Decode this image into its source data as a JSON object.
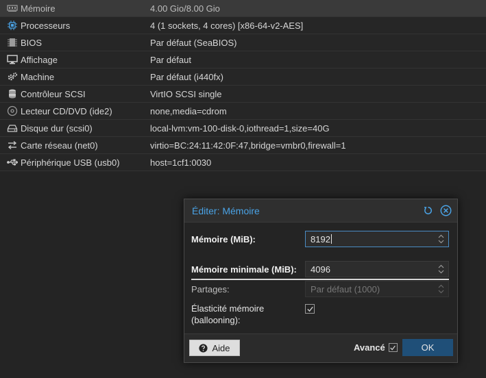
{
  "hardware": [
    {
      "icon": "memory-icon",
      "name": "Mémoire",
      "value": "4.00 Gio/8.00 Gio",
      "selected": true
    },
    {
      "icon": "cpu-icon",
      "name": "Processeurs",
      "value": "4 (1 sockets, 4 cores) [x86-64-v2-AES]"
    },
    {
      "icon": "chip-icon",
      "name": "BIOS",
      "value": "Par défaut (SeaBIOS)"
    },
    {
      "icon": "monitor-icon",
      "name": "Affichage",
      "value": "Par défaut"
    },
    {
      "icon": "gears-icon",
      "name": "Machine",
      "value": "Par défaut (i440fx)"
    },
    {
      "icon": "database-icon",
      "name": "Contrôleur SCSI",
      "value": "VirtIO SCSI single"
    },
    {
      "icon": "disc-icon",
      "name": "Lecteur CD/DVD (ide2)",
      "value": "none,media=cdrom"
    },
    {
      "icon": "hdd-icon",
      "name": "Disque dur (scsi0)",
      "value": "local-lvm:vm-100-disk-0,iothread=1,size=40G"
    },
    {
      "icon": "exchange-icon",
      "name": "Carte réseau (net0)",
      "value": "virtio=BC:24:11:42:0F:47,bridge=vmbr0,firewall=1"
    },
    {
      "icon": "usb-icon",
      "name": "Périphérique USB (usb0)",
      "value": "host=1cf1:0030"
    }
  ],
  "dialog": {
    "title": "Éditer: Mémoire",
    "memory_label": "Mémoire (MiB):",
    "memory_value": "8192",
    "min_memory_label": "Mémoire minimale (MiB):",
    "min_memory_value": "4096",
    "shares_label": "Partages:",
    "shares_placeholder": "Par défaut (1000)",
    "ballooning_label": "Élasticité mémoire (ballooning):",
    "ballooning_checked": true,
    "help_label": "Aide",
    "advanced_label": "Avancé",
    "advanced_checked": true,
    "ok_label": "OK"
  },
  "colors": {
    "accent": "#4aa3e6",
    "ok_button": "#1f4f78"
  }
}
